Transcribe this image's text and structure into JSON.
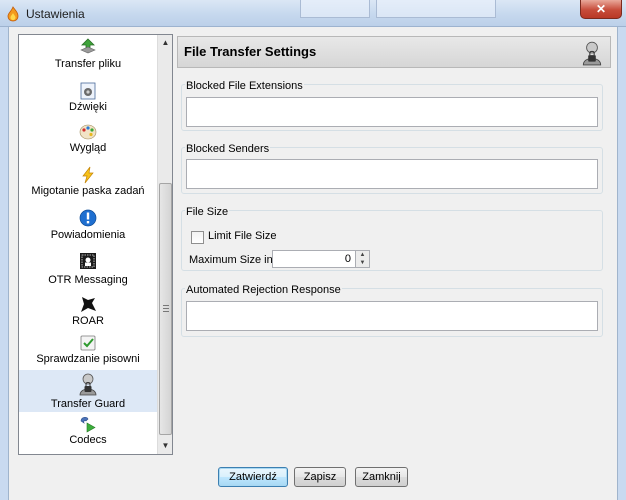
{
  "window": {
    "title": "Ustawienia",
    "close_glyph": "✕"
  },
  "sidebar": {
    "items": [
      {
        "label": "Transfer pliku",
        "icon": "file-transfer-icon"
      },
      {
        "label": "Dźwięki",
        "icon": "sounds-icon"
      },
      {
        "label": "Wygląd",
        "icon": "appearance-icon"
      },
      {
        "label": "Migotanie paska zadań",
        "icon": "taskbar-flash-icon"
      },
      {
        "label": "Powiadomienia",
        "icon": "notifications-icon"
      },
      {
        "label": "OTR Messaging",
        "icon": "otr-icon"
      },
      {
        "label": "ROAR",
        "icon": "roar-icon"
      },
      {
        "label": "Sprawdzanie pisowni",
        "icon": "spellcheck-icon"
      },
      {
        "label": "Transfer Guard",
        "icon": "transfer-guard-icon",
        "selected": true
      },
      {
        "label": "Codecs",
        "icon": "codecs-icon"
      }
    ],
    "scroll_up": "▲",
    "scroll_down": "▼"
  },
  "panel": {
    "title": "File Transfer Settings",
    "blocked_extensions": {
      "title": "Blocked File Extensions",
      "value": ""
    },
    "blocked_senders": {
      "title": "Blocked Senders",
      "value": ""
    },
    "file_size": {
      "title": "File Size",
      "limit_label": "Limit File Size",
      "limit_checked": false,
      "max_label": "Maximum Size in KB:",
      "max_value": "0"
    },
    "rejection": {
      "title": "Automated Rejection Response",
      "value": ""
    }
  },
  "buttons": {
    "confirm": "Zatwierdź",
    "save": "Zapisz",
    "close": "Zamknij"
  },
  "colors": {
    "selection": "#dde8f6",
    "titlebar": "#c6d8ee",
    "close_button": "#c74c3a"
  }
}
